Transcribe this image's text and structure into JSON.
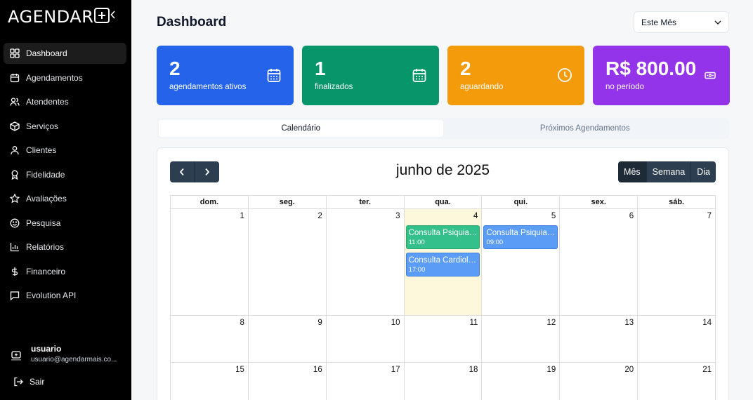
{
  "sidebar": {
    "brand": "AGENDAR",
    "items": [
      {
        "label": "Dashboard",
        "icon": "dashboard-icon"
      },
      {
        "label": "Agendamentos",
        "icon": "calendar-icon"
      },
      {
        "label": "Atendentes",
        "icon": "users-icon"
      },
      {
        "label": "Serviços",
        "icon": "box-icon"
      },
      {
        "label": "Clientes",
        "icon": "user-icon"
      },
      {
        "label": "Fidelidade",
        "icon": "award-icon"
      },
      {
        "label": "Avaliações",
        "icon": "star-icon"
      },
      {
        "label": "Pesquisa",
        "icon": "smile-icon"
      },
      {
        "label": "Relatórios",
        "icon": "bar-chart-icon"
      },
      {
        "label": "Financeiro",
        "icon": "dollar-icon"
      },
      {
        "label": "Evolution API",
        "icon": "message-icon"
      }
    ],
    "user": {
      "name": "usuario",
      "email": "usuario@agendarmais.co..."
    },
    "logout_label": "Sair"
  },
  "header": {
    "title": "Dashboard",
    "period": "Este Mês"
  },
  "stats": [
    {
      "value": "2",
      "label": "agendamentos ativos",
      "color": "#2563eb",
      "icon": "calendar-icon"
    },
    {
      "value": "1",
      "label": "finalizados",
      "color": "#079669",
      "icon": "calendar-icon"
    },
    {
      "value": "2",
      "label": "aguardando",
      "color": "#f49b0b",
      "icon": "clock-icon"
    },
    {
      "value": "R$ 800.00",
      "label": "no período",
      "color": "#9334ea",
      "icon": "money-icon"
    }
  ],
  "tabs": [
    "Calendário",
    "Próximos Agendamentos"
  ],
  "calendar": {
    "title": "junho de 2025",
    "views": [
      "Mês",
      "Semana",
      "Dia"
    ],
    "weekdays": [
      "dom.",
      "seg.",
      "ter.",
      "qua.",
      "qui.",
      "sex.",
      "sáb."
    ],
    "weeks": [
      [
        "1",
        "2",
        "3",
        "4",
        "5",
        "6",
        "7"
      ],
      [
        "8",
        "9",
        "10",
        "11",
        "12",
        "13",
        "14"
      ],
      [
        "15",
        "16",
        "17",
        "18",
        "19",
        "20",
        "21"
      ]
    ],
    "events": [
      {
        "title": "Consulta Psiquiatria",
        "time": "11:00",
        "color": "#34c08a"
      },
      {
        "title": "Consulta Cardiologia",
        "time": "17:00",
        "color": "#5b9cf6"
      },
      {
        "title": "Consulta Psiquiatria",
        "time": "09:00",
        "color": "#5b9cf6"
      }
    ]
  }
}
